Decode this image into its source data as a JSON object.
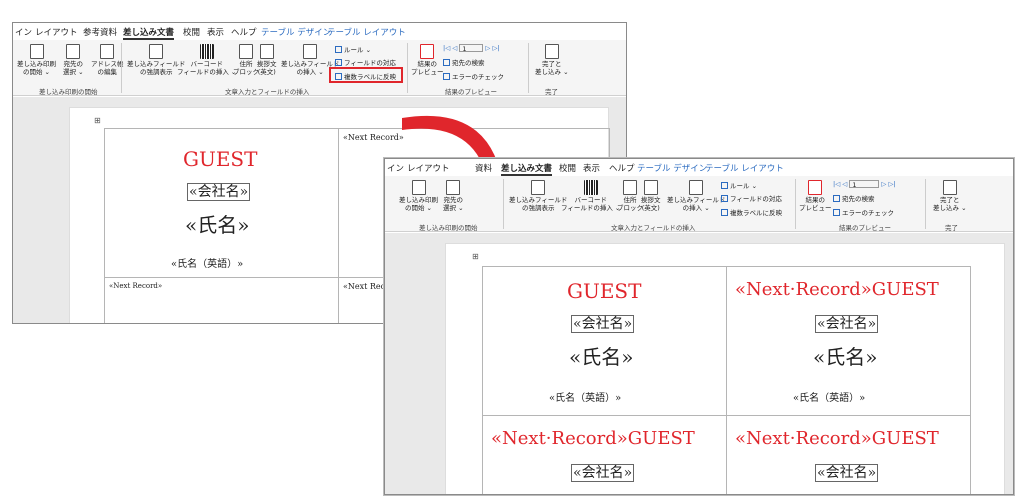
{
  "ribbon": {
    "tabs_w1": [
      "イン",
      "レイアウト",
      "参考資料",
      "差し込み文書",
      "校閲",
      "表示",
      "ヘルプ",
      "テーブル デザイン",
      "テーブル レイアウト"
    ],
    "tabs_w2": [
      "イン",
      "レイアウト",
      "資料",
      "差し込み文書",
      "校閲",
      "表示",
      "ヘルプ",
      "テーブル デザイン",
      "テーブル レイアウト"
    ],
    "start_merge": "差し込み印刷\nの開始 ⌄",
    "start_merge_w2": "差し込み印刷\nの開始 ⌄",
    "select_recipients": "宛先の\n選択 ⌄",
    "select_recipients_w2": "宛先の\n選択 ⌄",
    "edit_list": "アドレス帳\nの編集",
    "highlight_fields": "差し込みフィールド\nの強調表示",
    "barcode": "バーコード\nフィールドの挿入 ⌄",
    "address_block": "住所\nブロック",
    "greeting": "挨拶文\n(英文)",
    "insert_field": "差し込みフィールド\nの挿入 ⌄",
    "insert_field_w1": "差し込みフィールド\nの挿入 ⌄",
    "rules": "ルール ⌄",
    "match_fields": "フィールドの対応",
    "update_labels": "複数ラベルに反映",
    "preview_results": "結果の\nプレビュー",
    "record_number": "1",
    "find_recipient": "宛先の検索",
    "check_errors": "エラーのチェック",
    "finish_merge": "完了と\n差し込み ⌄",
    "group_start": "差し込み印刷の開始",
    "group_insert": "文章入力とフィールドの挿入",
    "group_preview": "結果のプレビュー",
    "group_finish": "完了"
  },
  "colors": {
    "accent": "#e0262c",
    "link": "#2b6bc0"
  },
  "icons": [
    "document-icon",
    "table-icon",
    "barcode-icon",
    "arrow-icon"
  ],
  "doc1": {
    "guest": "GUEST",
    "company": "«会社名»",
    "name": "«氏名»",
    "name_en": "«氏名（英語）»",
    "next_record": "«Next Record»",
    "next_record_a": "«Next Record»",
    "next_record_b": "«Next Record»",
    "next_record_c": "«Next Recor"
  },
  "doc2": {
    "guest": "GUEST",
    "company": "«会社名»",
    "name": "«氏名»",
    "name_en": "«氏名（英語）»",
    "next_guest": "«Next·Record»GUEST",
    "company_b": "«会社名»",
    "name_b": "«氏名»",
    "name_en_b": "«氏名（英語）»",
    "next_guest_c": "«Next·Record»GUEST",
    "next_guest_d": "«Next·Record»GUEST",
    "company_c": "«会社名»",
    "company_d": "«会社名»"
  }
}
